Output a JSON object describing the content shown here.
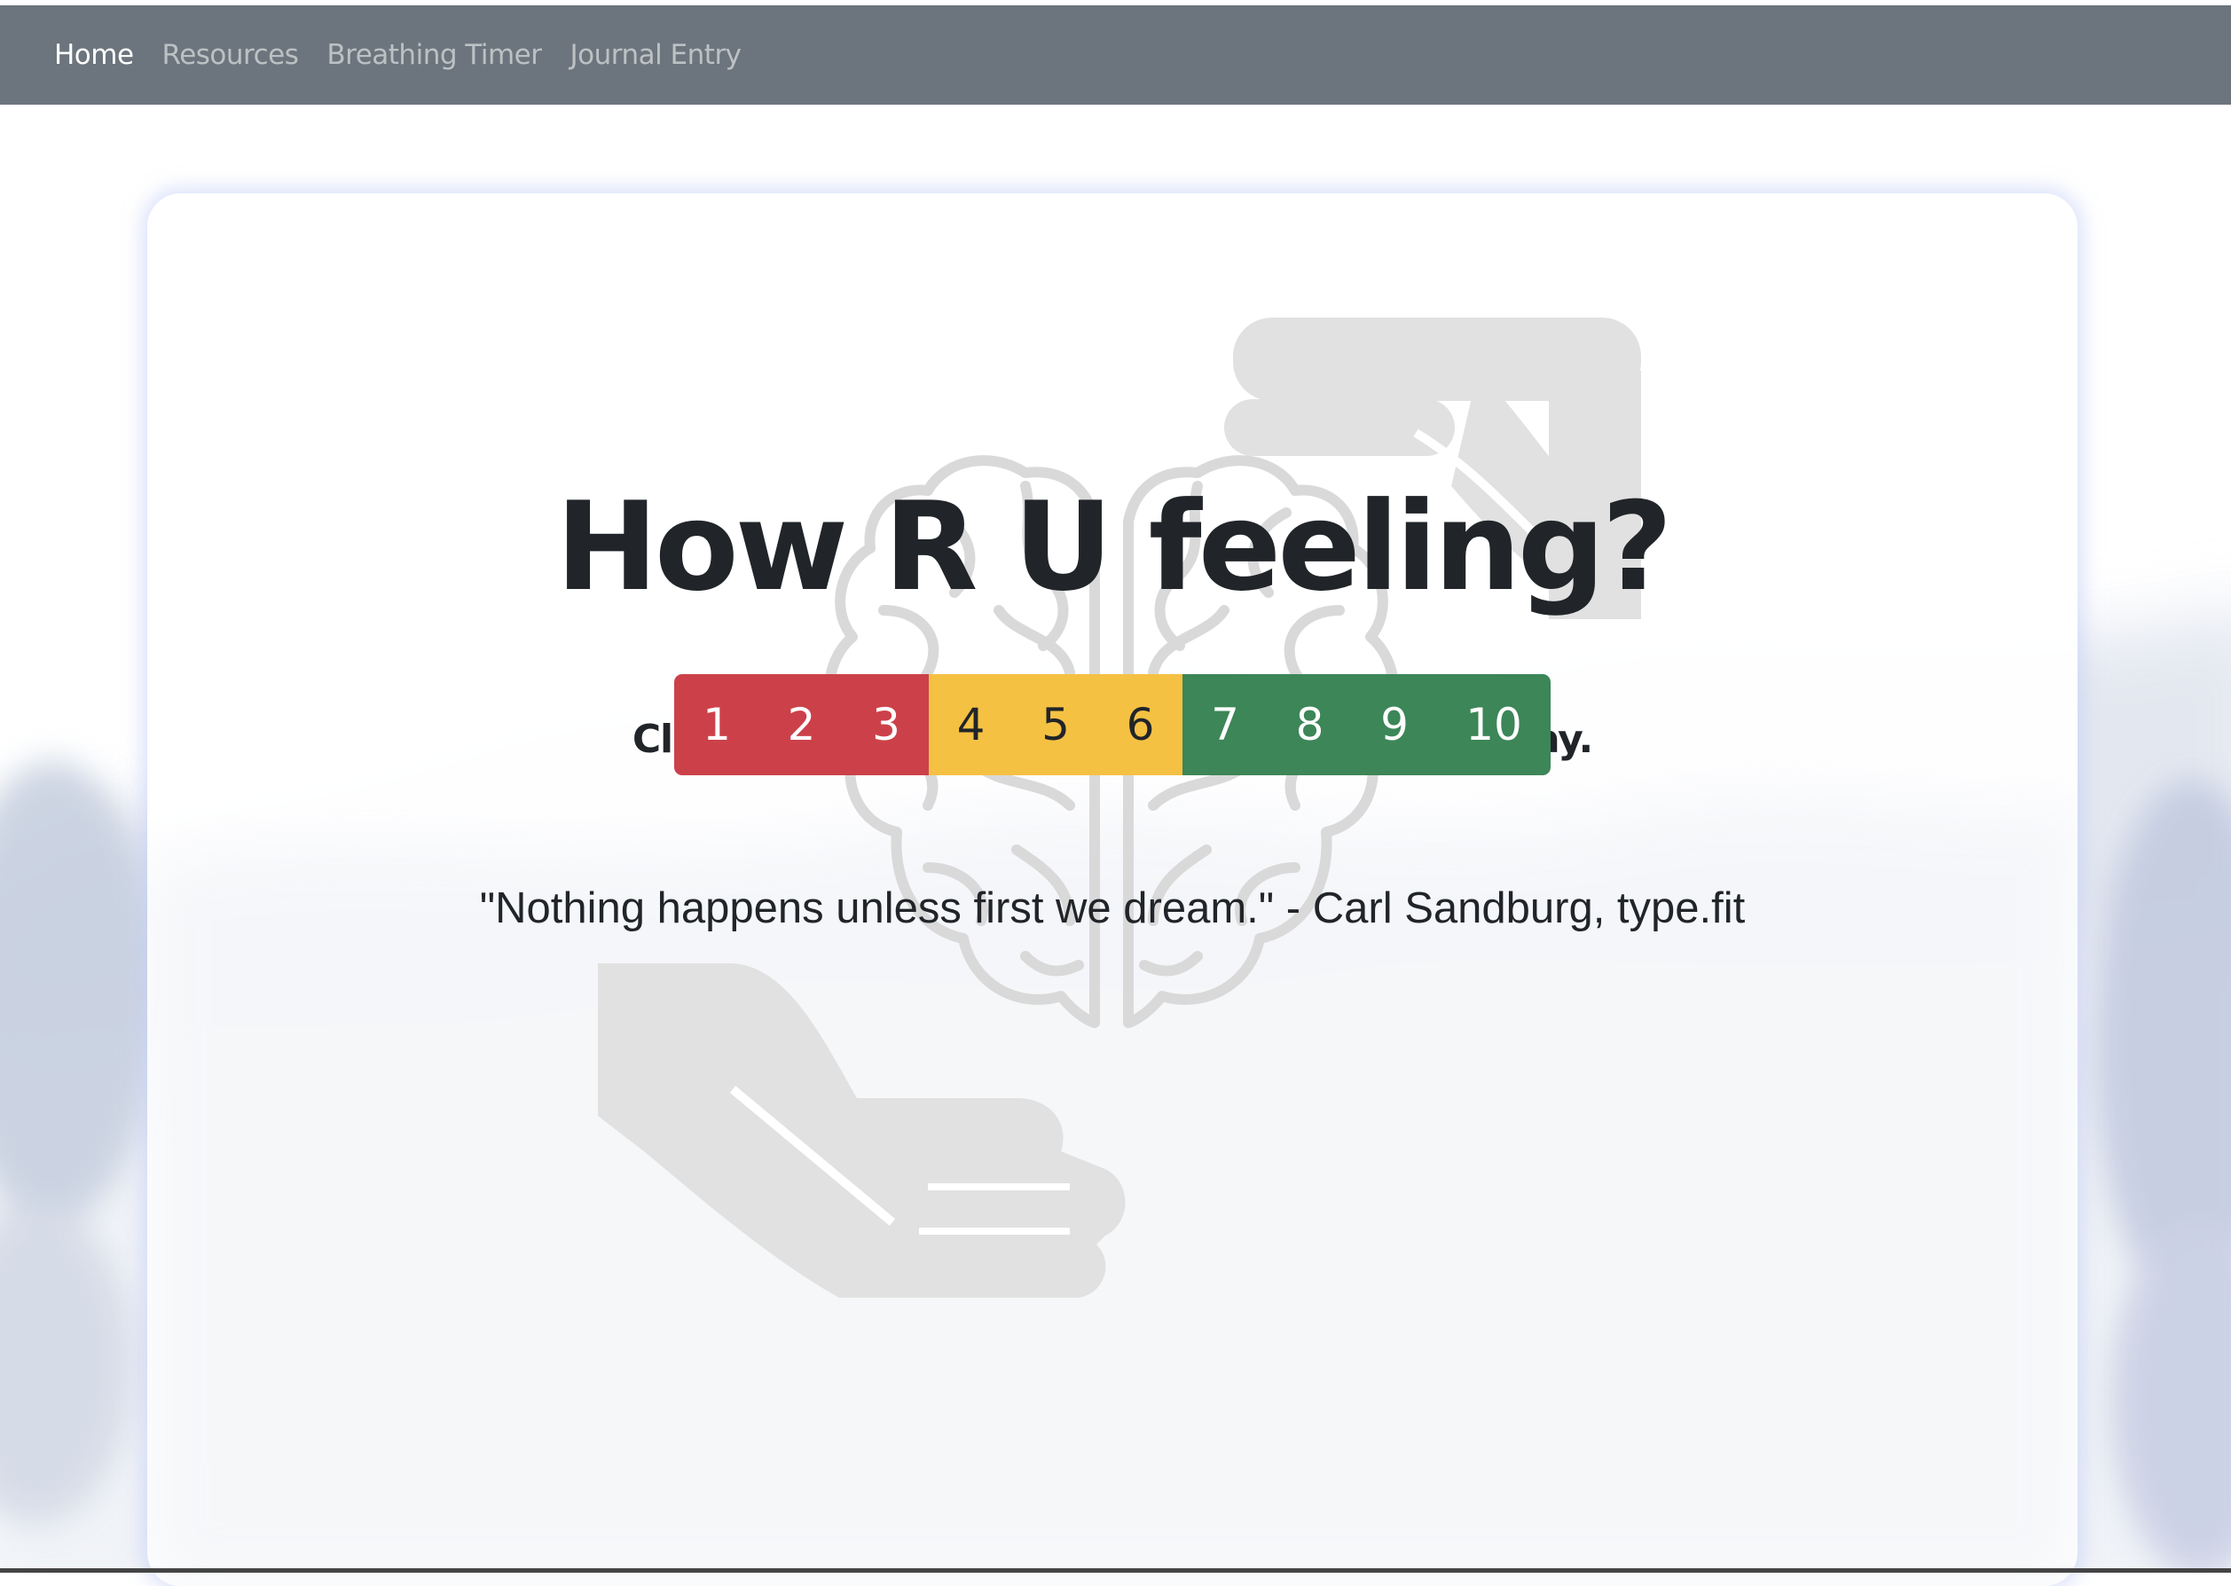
{
  "nav": {
    "items": [
      {
        "label": "Home",
        "active": true
      },
      {
        "label": "Resources",
        "active": false
      },
      {
        "label": "Breathing Timer",
        "active": false
      },
      {
        "label": "Journal Entry",
        "active": false
      }
    ]
  },
  "main": {
    "title": "How R U feeling?",
    "subtitle": "Click on scale to log how you're feeling today.",
    "scale": [
      {
        "label": "1",
        "color": "red"
      },
      {
        "label": "2",
        "color": "red"
      },
      {
        "label": "3",
        "color": "red"
      },
      {
        "label": "4",
        "color": "yellow"
      },
      {
        "label": "5",
        "color": "yellow"
      },
      {
        "label": "6",
        "color": "yellow"
      },
      {
        "label": "7",
        "color": "green"
      },
      {
        "label": "8",
        "color": "green"
      },
      {
        "label": "9",
        "color": "green"
      },
      {
        "label": "10",
        "color": "green"
      }
    ],
    "quote": "\"Nothing happens unless first we dream.\" - Carl Sandburg, type.fit"
  },
  "icons": {
    "background_art": [
      "brain-icon",
      "hand-icon"
    ]
  },
  "colors": {
    "navbar": "#6c757d",
    "scale_red": "#cc4149",
    "scale_yellow": "#f5c143",
    "scale_green": "#3c8657",
    "text": "#212529"
  }
}
